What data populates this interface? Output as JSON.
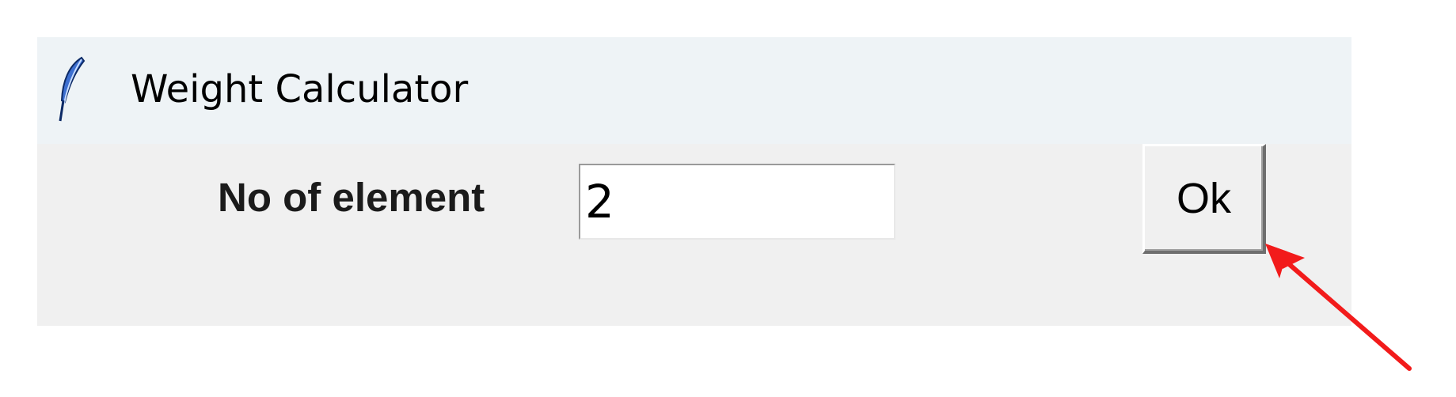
{
  "window": {
    "title": "Weight Calculator",
    "icon": "feather-icon"
  },
  "form": {
    "label": "No of element",
    "entry_value": "2",
    "ok_label": "Ok"
  },
  "annotation": {
    "type": "arrow",
    "color": "#ff0000",
    "points_to": "ok-button"
  }
}
